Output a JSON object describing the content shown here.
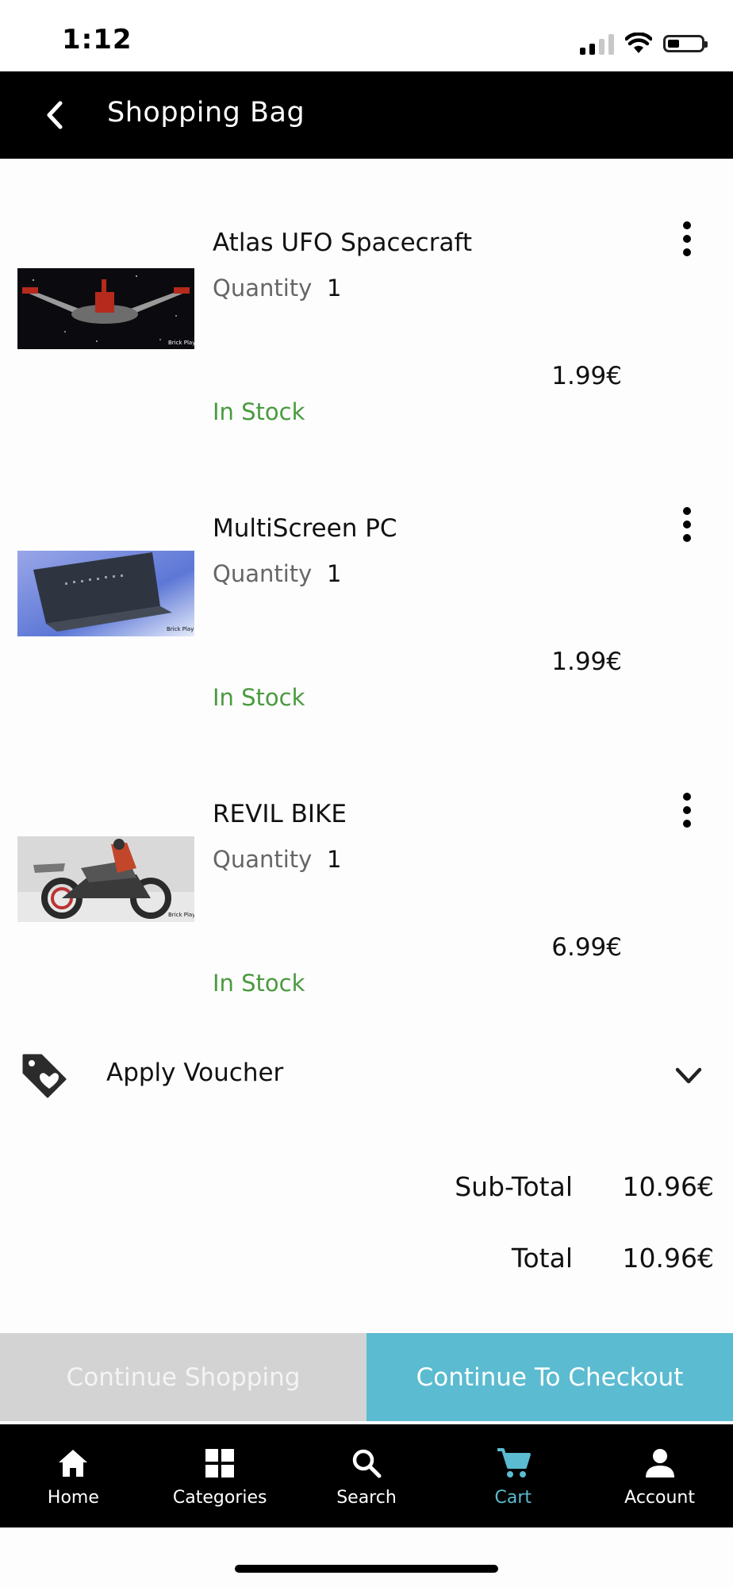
{
  "status_bar": {
    "time": "1:12"
  },
  "header": {
    "title": "Shopping Bag"
  },
  "cart": {
    "items": [
      {
        "name": "Atlas UFO Spacecraft",
        "quantity_label": "Quantity",
        "quantity": "1",
        "price": "1.99€",
        "stock": "In Stock"
      },
      {
        "name": "MultiScreen PC",
        "quantity_label": "Quantity",
        "quantity": "1",
        "price": "1.99€",
        "stock": "In Stock"
      },
      {
        "name": "REVIL BIKE",
        "quantity_label": "Quantity",
        "quantity": "1",
        "price": "6.99€",
        "stock": "In Stock"
      }
    ]
  },
  "voucher": {
    "label": "Apply Voucher"
  },
  "totals": {
    "subtotal_label": "Sub-Total",
    "subtotal_value": "10.96€",
    "total_label": "Total",
    "total_value": "10.96€"
  },
  "actions": {
    "continue_shopping": "Continue Shopping",
    "checkout": "Continue To Checkout"
  },
  "tab_bar": {
    "active": "Cart",
    "tabs": [
      {
        "label": "Home",
        "icon": "home-icon"
      },
      {
        "label": "Categories",
        "icon": "grid-icon"
      },
      {
        "label": "Search",
        "icon": "search-icon"
      },
      {
        "label": "Cart",
        "icon": "cart-icon"
      },
      {
        "label": "Account",
        "icon": "person-icon"
      }
    ]
  },
  "colors": {
    "accent": "#5bbbd0",
    "stock_green": "#4a9a3f",
    "header_bg": "#000000"
  }
}
